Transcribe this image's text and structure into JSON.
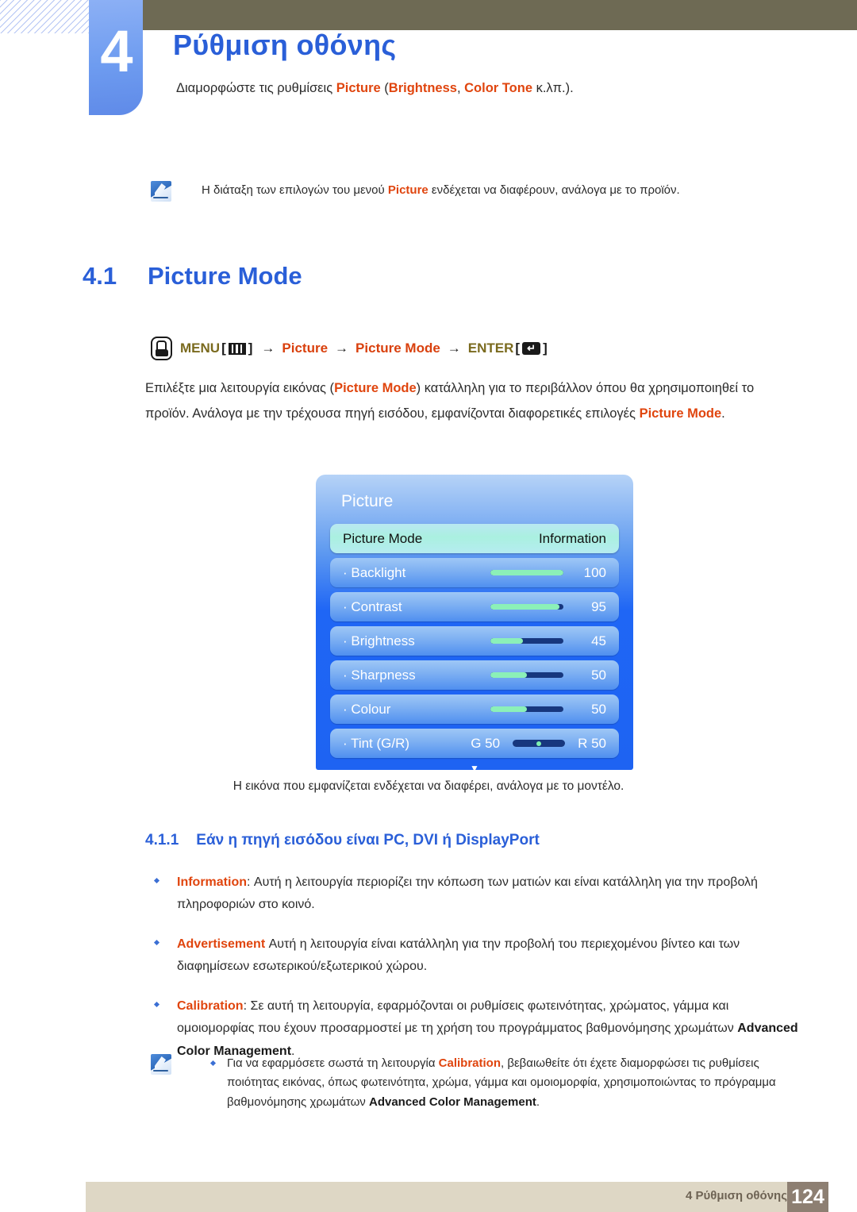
{
  "header": {
    "chapter_number": "4",
    "chapter_title": "Ρύθμιση οθόνης",
    "chapter_sub_pre": "Διαμορφώστε τις ρυθμίσεις ",
    "chapter_sub_b1": "Picture",
    "chapter_sub_mid1": " (",
    "chapter_sub_b2": "Brightness",
    "chapter_sub_mid2": ", ",
    "chapter_sub_b3": "Color Tone",
    "chapter_sub_post": " κ.λπ.)."
  },
  "top_note": {
    "icon": "note-pen-icon",
    "pre": "Η διάταξη των επιλογών του μενού ",
    "bold": "Picture",
    "post": " ενδέχεται να διαφέρουν, ανάλογα με το προϊόν."
  },
  "section": {
    "number": "4.1",
    "title": "Picture Mode"
  },
  "menu_path": {
    "hand_icon": "hand-press-icon",
    "menu_label": "MENU",
    "menu_icon": "menu-bars-icon",
    "arrow": "→",
    "picture_label": "Picture",
    "picture_mode_label": "Picture Mode",
    "enter_label": "ENTER",
    "enter_icon": "enter-return-icon",
    "enter_glyph": "↵",
    "bracket_open": "[",
    "bracket_close": "]"
  },
  "paragraph": {
    "p1": "Επιλέξτε μια λειτουργία εικόνας (",
    "b1": "Picture Mode",
    "p2": ") κατάλληλη για το περιβάλλον όπου θα χρησιμοποιηθεί το προϊόν. Ανάλογα με την τρέχουσα πηγή εισόδου, εμφανίζονται διαφορετικές επιλογές ",
    "b2": "Picture Mode",
    "p3": "."
  },
  "osd": {
    "title": "Picture",
    "scroll_arrow": "▼",
    "rows": [
      {
        "label": "Picture Mode",
        "type": "option",
        "value": "Information",
        "selected": true
      },
      {
        "label": "· Backlight",
        "type": "slider",
        "value": "100",
        "fill": 100,
        "selected": false
      },
      {
        "label": "· Contrast",
        "type": "slider",
        "value": "95",
        "fill": 95,
        "selected": false
      },
      {
        "label": "· Brightness",
        "type": "slider",
        "value": "45",
        "fill": 45,
        "selected": false
      },
      {
        "label": "· Sharpness",
        "type": "slider",
        "value": "50",
        "fill": 50,
        "selected": false
      },
      {
        "label": "· Colour",
        "type": "slider",
        "value": "50",
        "fill": 50,
        "selected": false
      },
      {
        "label": "· Tint (G/R)",
        "type": "tint",
        "left_value": "G 50",
        "right_value": "R 50",
        "selected": false
      }
    ]
  },
  "caption": "Η εικόνα που εμφανίζεται ενδέχεται να διαφέρει, ανάλογα με το μοντέλο.",
  "subsection": {
    "number": "4.1.1",
    "title": "Εάν η πηγή εισόδου είναι PC, DVI ή DisplayPort"
  },
  "bullets": [
    {
      "term": "Information",
      "sep": ": ",
      "text": "Αυτή η λειτουργία περιορίζει την κόπωση των ματιών και είναι κατάλληλη για την προβολή πληροφοριών στο κοινό."
    },
    {
      "term": "Advertisement",
      "sep": " ",
      "text": "Αυτή η λειτουργία είναι κατάλληλη για την προβολή του περιεχομένου βίντεο και των διαφημίσεων εσωτερικού/εξωτερικού χώρου."
    },
    {
      "term": "Calibration",
      "sep": ": ",
      "text": "Σε αυτή τη λειτουργία, εφαρμόζονται οι ρυθμίσεις φωτεινότητας, χρώματος, γάμμα και ομοιομορφίας που έχουν προσαρμοστεί με τη χρήση του προγράμματος βαθμονόμησης χρωμάτων ",
      "bold_tail": "Advanced Color Management",
      "tail": "."
    }
  ],
  "bottom_note": {
    "icon": "note-pen-icon",
    "pre": "Για να εφαρμόσετε σωστά τη λειτουργία ",
    "term": "Calibration",
    "mid": ", βεβαιωθείτε ότι έχετε διαμορφώσει τις ρυθμίσεις ποιότητας εικόνας, όπως φωτεινότητα, χρώμα, γάμμα και ομοιομορφία, χρησιμοποιώντας το πρόγραμμα βαθμονόμησης χρωμάτων ",
    "bold_tail": "Advanced Color Management",
    "tail": "."
  },
  "footer": {
    "text": "4 Ρύθμιση οθόνης",
    "page": "124"
  },
  "colors": {
    "heading_blue": "#2a5fd8",
    "accent_orange": "#e0450e",
    "olive_bar": "#6e6a54",
    "menu_olive": "#7a6a1e",
    "footer_bar": "#ded7c5",
    "footer_page_box": "#8d7f72",
    "osd_blue": "#1f66f5",
    "osd_selected": "#aaf0e0",
    "slider_fill": "#8bf0b8",
    "slider_track": "#17377e"
  }
}
